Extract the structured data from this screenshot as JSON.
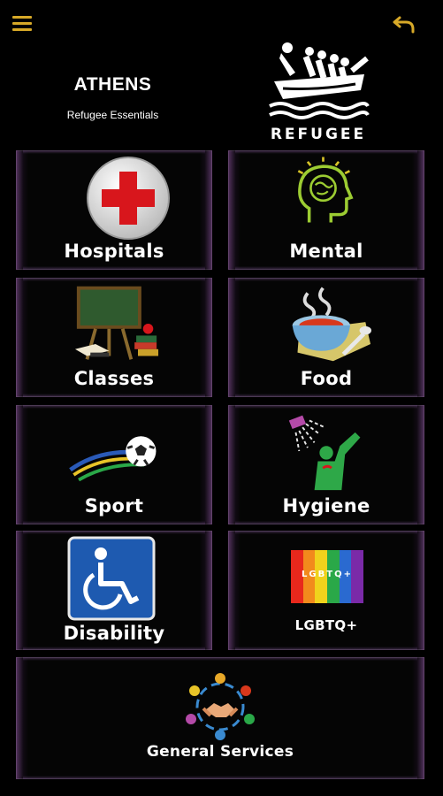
{
  "header": {
    "title": "ATHENS",
    "subtitle": "Refugee Essentials",
    "logo_text": "REFUGEE"
  },
  "topbar": {
    "menu_icon": "hamburger-menu-icon",
    "back_icon": "undo-arrow-icon"
  },
  "colors": {
    "accent": "#d7a928",
    "tile_glow": "#9a5aaa",
    "background": "#000000"
  },
  "tiles": [
    {
      "label": "Hospitals",
      "icon": "red-cross-icon"
    },
    {
      "label": "Mental",
      "icon": "brain-head-icon"
    },
    {
      "label": "Classes",
      "icon": "chalkboard-icon"
    },
    {
      "label": "Food",
      "icon": "soup-bowl-icon"
    },
    {
      "label": "Sport",
      "icon": "soccer-ball-icon"
    },
    {
      "label": "Hygiene",
      "icon": "shower-icon"
    },
    {
      "label": "Disability",
      "icon": "wheelchair-icon"
    },
    {
      "label": "LGBTQ+",
      "icon": "rainbow-flag-icon",
      "flag_text": "LGBTQ+"
    },
    {
      "label": "General Services",
      "icon": "handshake-network-icon"
    }
  ]
}
